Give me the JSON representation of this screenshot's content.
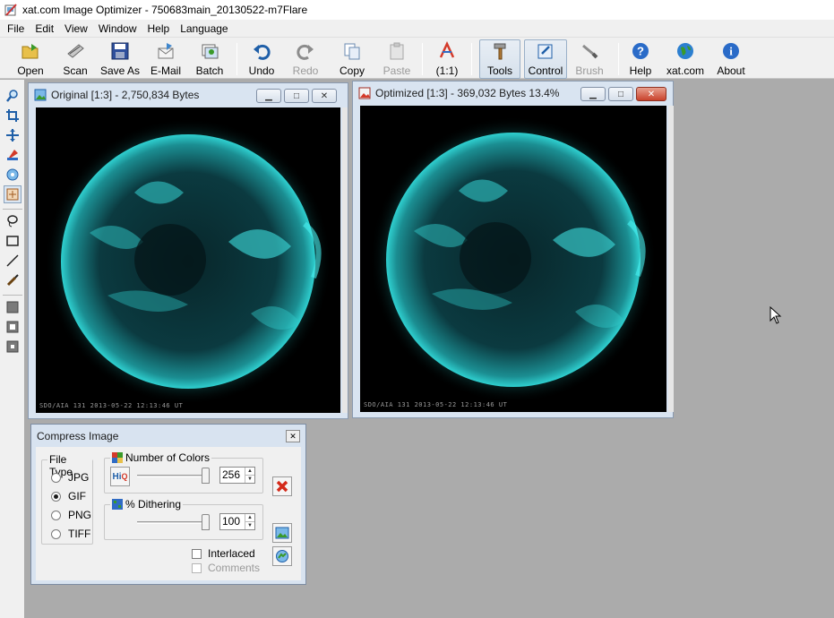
{
  "window": {
    "title": "xat.com  Image Optimizer - 750683main_20130522-m7Flare"
  },
  "menu": [
    "File",
    "Edit",
    "View",
    "Window",
    "Help",
    "Language"
  ],
  "toolbar": {
    "open": "Open",
    "scan": "Scan",
    "save_as": "Save As",
    "email": "E-Mail",
    "batch": "Batch",
    "undo": "Undo",
    "redo": "Redo",
    "copy": "Copy",
    "paste": "Paste",
    "actual": "(1:1)",
    "tools": "Tools",
    "control": "Control",
    "brush": "Brush",
    "help": "Help",
    "xat": "xat.com",
    "about": "About"
  },
  "original": {
    "title": "Original [1:3] - 2,750,834 Bytes",
    "caption": "SDO/AIA  131    2013-05-22 12:13:46 UT"
  },
  "optimized": {
    "title": "Optimized [1:3] - 369,032 Bytes 13.4%",
    "caption": "SDO/AIA  131    2013-05-22 12:13:46 UT"
  },
  "compress": {
    "title": "Compress Image",
    "file_type_label": "File Type",
    "types": [
      "JPG",
      "GIF",
      "PNG",
      "TIFF"
    ],
    "selected": "GIF",
    "colors_label": "Number of Colors",
    "colors_value": "256",
    "dither_label": "% Dithering",
    "dither_value": "100",
    "hiq_label": "Hi",
    "hiq_sub": "Q",
    "interlaced": "Interlaced",
    "comments": "Comments"
  },
  "colors": {
    "accent": "#1f5fa8",
    "sun": "#27c4c4",
    "window_frame": "#d9e4f1",
    "workspace": "#ababab"
  }
}
